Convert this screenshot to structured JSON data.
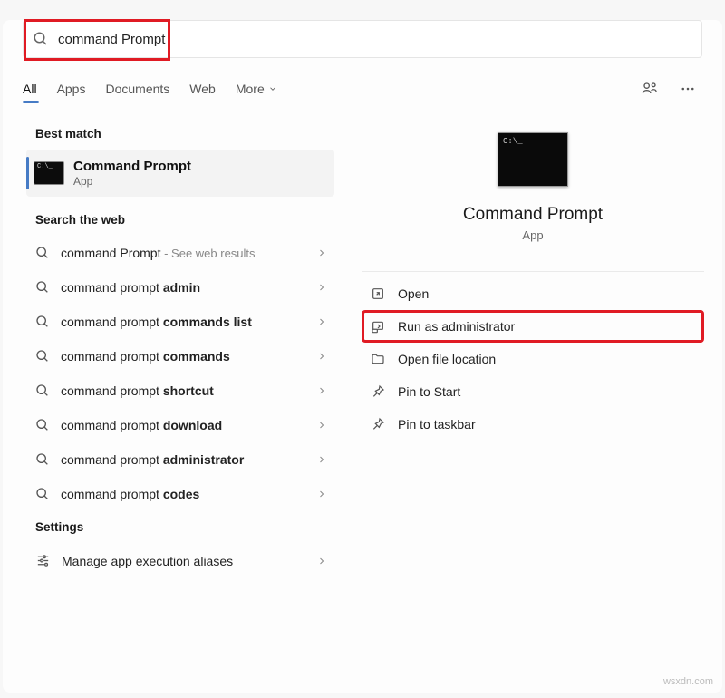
{
  "search": {
    "value": "command Prompt"
  },
  "tabs": {
    "items": [
      "All",
      "Apps",
      "Documents",
      "Web"
    ],
    "more": "More",
    "activeIndex": 0
  },
  "left": {
    "bestMatchLabel": "Best match",
    "bestMatch": {
      "title": "Command Prompt",
      "sub": "App"
    },
    "webLabel": "Search the web",
    "webResults": [
      {
        "prefix": "command Prompt",
        "bold": "",
        "hint": " - See web results"
      },
      {
        "prefix": "command prompt ",
        "bold": "admin",
        "hint": ""
      },
      {
        "prefix": "command prompt ",
        "bold": "commands list",
        "hint": ""
      },
      {
        "prefix": "command prompt ",
        "bold": "commands",
        "hint": ""
      },
      {
        "prefix": "command prompt ",
        "bold": "shortcut",
        "hint": ""
      },
      {
        "prefix": "command prompt ",
        "bold": "download",
        "hint": ""
      },
      {
        "prefix": "command prompt ",
        "bold": "administrator",
        "hint": ""
      },
      {
        "prefix": "command prompt ",
        "bold": "codes",
        "hint": ""
      }
    ],
    "settingsLabel": "Settings",
    "settingsItems": [
      "Manage app execution aliases"
    ]
  },
  "right": {
    "title": "Command Prompt",
    "sub": "App",
    "actions": [
      {
        "icon": "open",
        "label": "Open"
      },
      {
        "icon": "admin",
        "label": "Run as administrator",
        "highlight": true
      },
      {
        "icon": "folder",
        "label": "Open file location"
      },
      {
        "icon": "pin",
        "label": "Pin to Start"
      },
      {
        "icon": "pin",
        "label": "Pin to taskbar"
      }
    ]
  },
  "watermark": "wsxdn.com"
}
